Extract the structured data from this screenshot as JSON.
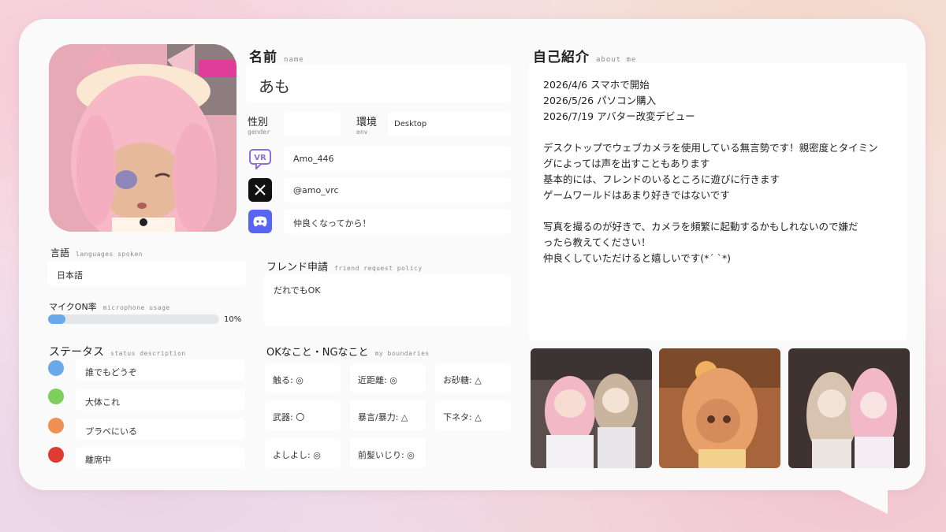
{
  "name": {
    "label": "名前",
    "sub": "name",
    "value": "あも"
  },
  "gender": {
    "label": "性別",
    "sub": "gender",
    "value": ""
  },
  "env": {
    "label": "環境",
    "sub": "env",
    "value": "Desktop"
  },
  "vrchat": {
    "icon": "vrchat-icon",
    "value": "Amo_446"
  },
  "x": {
    "icon": "x-logo-icon",
    "value": "@amo_vrc"
  },
  "discord": {
    "icon": "discord-icon",
    "value": "仲良くなってから！"
  },
  "languages": {
    "label": "言語",
    "sub": "languages spoken",
    "value": "日本語"
  },
  "mic": {
    "label": "マイクON率",
    "sub": "microphone usage",
    "value": "10%",
    "percent": 10
  },
  "status": {
    "label": "ステータス",
    "sub": "status description",
    "items": [
      {
        "color": "#6aa9e9",
        "label": "誰でもどうぞ"
      },
      {
        "color": "#7ccf5b",
        "label": "大体これ"
      },
      {
        "color": "#ef9155",
        "label": "プラベにいる"
      },
      {
        "color": "#e03a32",
        "label": "離席中"
      }
    ]
  },
  "friend_request": {
    "label": "フレンド申請",
    "sub": "friend request policy",
    "value": "だれでもOK"
  },
  "boundaries": {
    "label": "OKなこと・NGなこと",
    "sub": "my boundaries",
    "items": [
      "触る: ◎",
      "近距離: ◎",
      "お砂糖: △",
      "武器: 〇",
      "暴言/暴力: △",
      "下ネタ: △",
      "よしよし: ◎",
      "前髪いじり: ◎"
    ]
  },
  "about": {
    "label": "自己紹介",
    "sub": "about me",
    "lines": [
      "2026/4/6 スマホで開始",
      "2026/5/26 パソコン購入",
      "2026/7/19 アバター改変デビュー",
      "",
      "デスクトップでウェブカメラを使用している無言勢です！親密度とタイミン",
      "グによっては声を出すこともあります",
      "基本的には、フレンドのいるところに遊びに行きます",
      "ゲームワールドはあまり好きではないです",
      "",
      "写真を撮るのが好きで、カメラを頻繁に起動するかもしれないので嫌だ",
      "ったら教えてください！",
      "仲良くしていただけると嬉しいです(*´ `*)"
    ]
  },
  "colors": {
    "card": "#fbfafa",
    "accent": "#6aa9e9",
    "discord": "#5865f2",
    "vrchat": "#8a6fd8"
  }
}
